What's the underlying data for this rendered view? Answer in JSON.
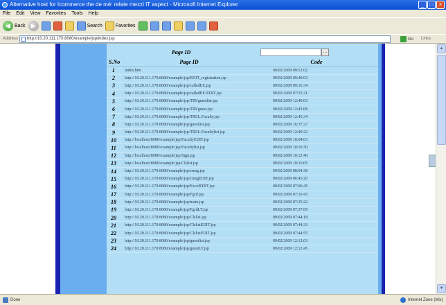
{
  "window": {
    "title": "Alternative host for Icommerce the de mé: relate mezzi IT aspect - Microsoft Internet Explorer",
    "buttons": {
      "minimize": "_",
      "maximize": "□",
      "close": "×"
    }
  },
  "menubar": [
    "File",
    "Edit",
    "View",
    "Favorites",
    "Tools",
    "Help"
  ],
  "toolbar": {
    "back": "Back",
    "search": "Search",
    "favorites": "Favorites"
  },
  "address": {
    "label": "Address",
    "url": "http://10.20.111.170:8080/example/jsp/index.jsp",
    "go": "Go",
    "links": "Links"
  },
  "page": {
    "page_id_label": "Page ID",
    "page_id_value": "",
    "page_id_button": "…"
  },
  "table": {
    "headers": {
      "sno": "S.No",
      "page_id": "Page ID",
      "code": "Code"
    },
    "rows": [
      {
        "sno": "1",
        "page_id": "index.htm",
        "code": "09/02/2009 09:52:02"
      },
      {
        "sno": "2",
        "page_id": "http://10.20.111.170:8080/example/jsp/EDIT_registration.jsp",
        "code": "09/02/2009 09:49:03"
      },
      {
        "sno": "3",
        "page_id": "http://10.20.111.170:8080/example/jsp/calledEE.jsp",
        "code": "09/02/2009 09:16:34"
      },
      {
        "sno": "4",
        "page_id": "http://10.20.111.170:8080/example/jsp/calledEE-EDIT.jsp",
        "code": "09/02/2009 07:55:21"
      },
      {
        "sno": "5",
        "page_id": "http://10.20.111.170:8080/example/jsp/TRI/guestlist.jsp",
        "code": "09/02/2009 12:40:03"
      },
      {
        "sno": "6",
        "page_id": "http://10.20.111.170:8080/example/jsp/TRI/guest.jsp",
        "code": "09/02/2009 12:43:08"
      },
      {
        "sno": "7",
        "page_id": "http://10.20.111.170:8080/example/jsp/TRI/L.Faculty.jsp",
        "code": "09/02/2009 12:45:34"
      },
      {
        "sno": "8",
        "page_id": "http://10.20.111.170:8080/example/jsp/guestlist.jsp",
        "code": "09/02/2009 16:37:27"
      },
      {
        "sno": "9",
        "page_id": "http://10.20.111.170:8080/example/jsp/TRI/L.Facultylist.jsp",
        "code": "09/02/2009 12:40:22"
      },
      {
        "sno": "10",
        "page_id": "http://localhost:8080/example/jsp/FacultyEDIT.jsp",
        "code": "09/02/2009 10:04:03"
      },
      {
        "sno": "11",
        "page_id": "http://localhost:8080/example/jsp/Facultylist.jsp",
        "code": "09/02/2009 10:10:30"
      },
      {
        "sno": "12",
        "page_id": "http://localhost:8080/example/jsp/Sign.jsp",
        "code": "09/02/2009 10:12:40"
      },
      {
        "sno": "13",
        "page_id": "http://localhost:8080/example/jsp/Clslist.jsp",
        "code": "09/02/2009 10:16:05"
      },
      {
        "sno": "14",
        "page_id": "http://10.20.111.170:8080/example/jsp/cmsg.jsp",
        "code": "09/02/2009 08:04:38"
      },
      {
        "sno": "15",
        "page_id": "http://10.20.111.170:8080/example/jsp/cmsgEDIT.jsp",
        "code": "09/02/2009 06:45:20"
      },
      {
        "sno": "16",
        "page_id": "http://10.20.111.170:8080/example/jsp/ExcelEDIT.jsp",
        "code": "09/02/2009 07:06:45"
      },
      {
        "sno": "17",
        "page_id": "http://10.20.111.170:8080/example/jsp/Fgrd.jsp",
        "code": "09/02/2009 07:16:43"
      },
      {
        "sno": "18",
        "page_id": "http://10.20.111.170:8080/example/jsp/main.jsp",
        "code": "09/02/2009 07:35:22"
      },
      {
        "sno": "19",
        "page_id": "http://10.20.111.170:8080/example/jsp/FgrdLT.jsp",
        "code": "09/02/2009 07:37:09"
      },
      {
        "sno": "20",
        "page_id": "http://10.20.111.170:8080/example/jsp/Clslist.jsp",
        "code": "09/02/2009 07:44:18"
      },
      {
        "sno": "21",
        "page_id": "http://10.20.111.170:8080/example/jsp/ClslistEDIT.jsp",
        "code": "09/02/2009 07:44:33"
      },
      {
        "sno": "22",
        "page_id": "http://10.20.111.170:8080/example/jsp/ClslistEDIT.jsp",
        "code": "09/02/2009 07:44:55"
      },
      {
        "sno": "23",
        "page_id": "http://10.20.111.170:8080/example/jsp/guestlist.jsp",
        "code": "09/02/2009 12:12:03"
      },
      {
        "sno": "24",
        "page_id": "http://10.20.111.170:8080/example/jsp/guestLT.jsp",
        "code": "09/02/2009 12:12:45"
      }
    ]
  },
  "status": {
    "left": "Done",
    "right": "Internet Zone (Mix)"
  },
  "colors": {
    "panel_bg": "#b3dff6",
    "band_light": "#6aaef0",
    "band_dark": "#1a22b0"
  }
}
